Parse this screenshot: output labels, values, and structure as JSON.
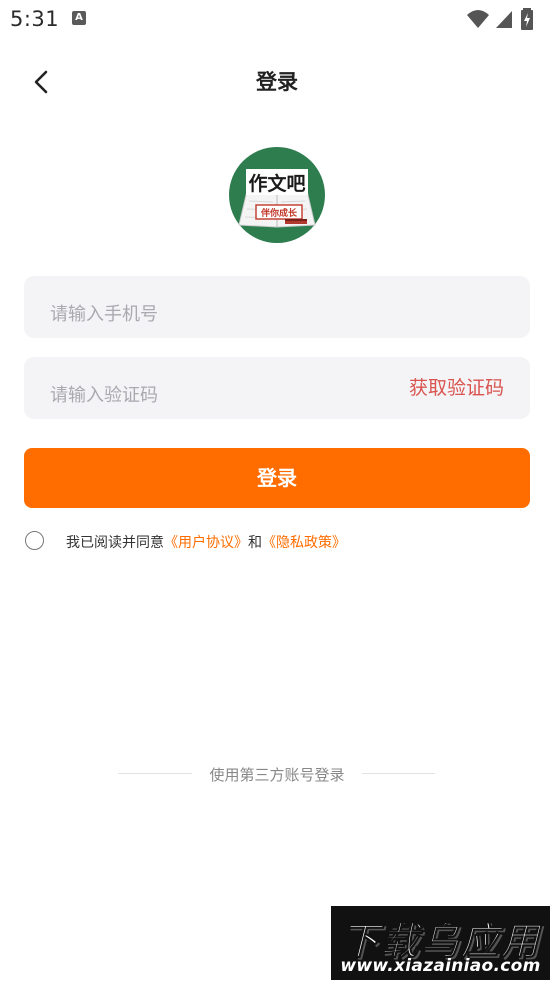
{
  "status_bar": {
    "time": "5:31",
    "notification_icon": "a-icon",
    "icons": [
      "wifi-icon",
      "signal-icon",
      "battery-charging-icon"
    ]
  },
  "header": {
    "back_icon": "chevron-left-icon",
    "title": "登录"
  },
  "logo": {
    "title": "作文吧",
    "slogan": "伴你成长",
    "bg_color": "#2e7d4f"
  },
  "form": {
    "phone_placeholder": "请输入手机号",
    "phone_value": "",
    "code_placeholder": "请输入验证码",
    "code_value": "",
    "get_code_label": "获取验证码",
    "login_label": "登录"
  },
  "agreement": {
    "checked": false,
    "prefix": "我已阅读并同意",
    "user_agreement": "《用户协议》",
    "and": "和",
    "privacy_policy": "《隐私政策》"
  },
  "third_party": {
    "label": "使用第三方账号登录"
  },
  "watermark": {
    "title": "下载乌应用",
    "url": "www.xiazainiao.com"
  },
  "colors": {
    "accent": "#ff6d00",
    "get_code": "#d9534f",
    "input_bg": "#f4f4f6"
  }
}
